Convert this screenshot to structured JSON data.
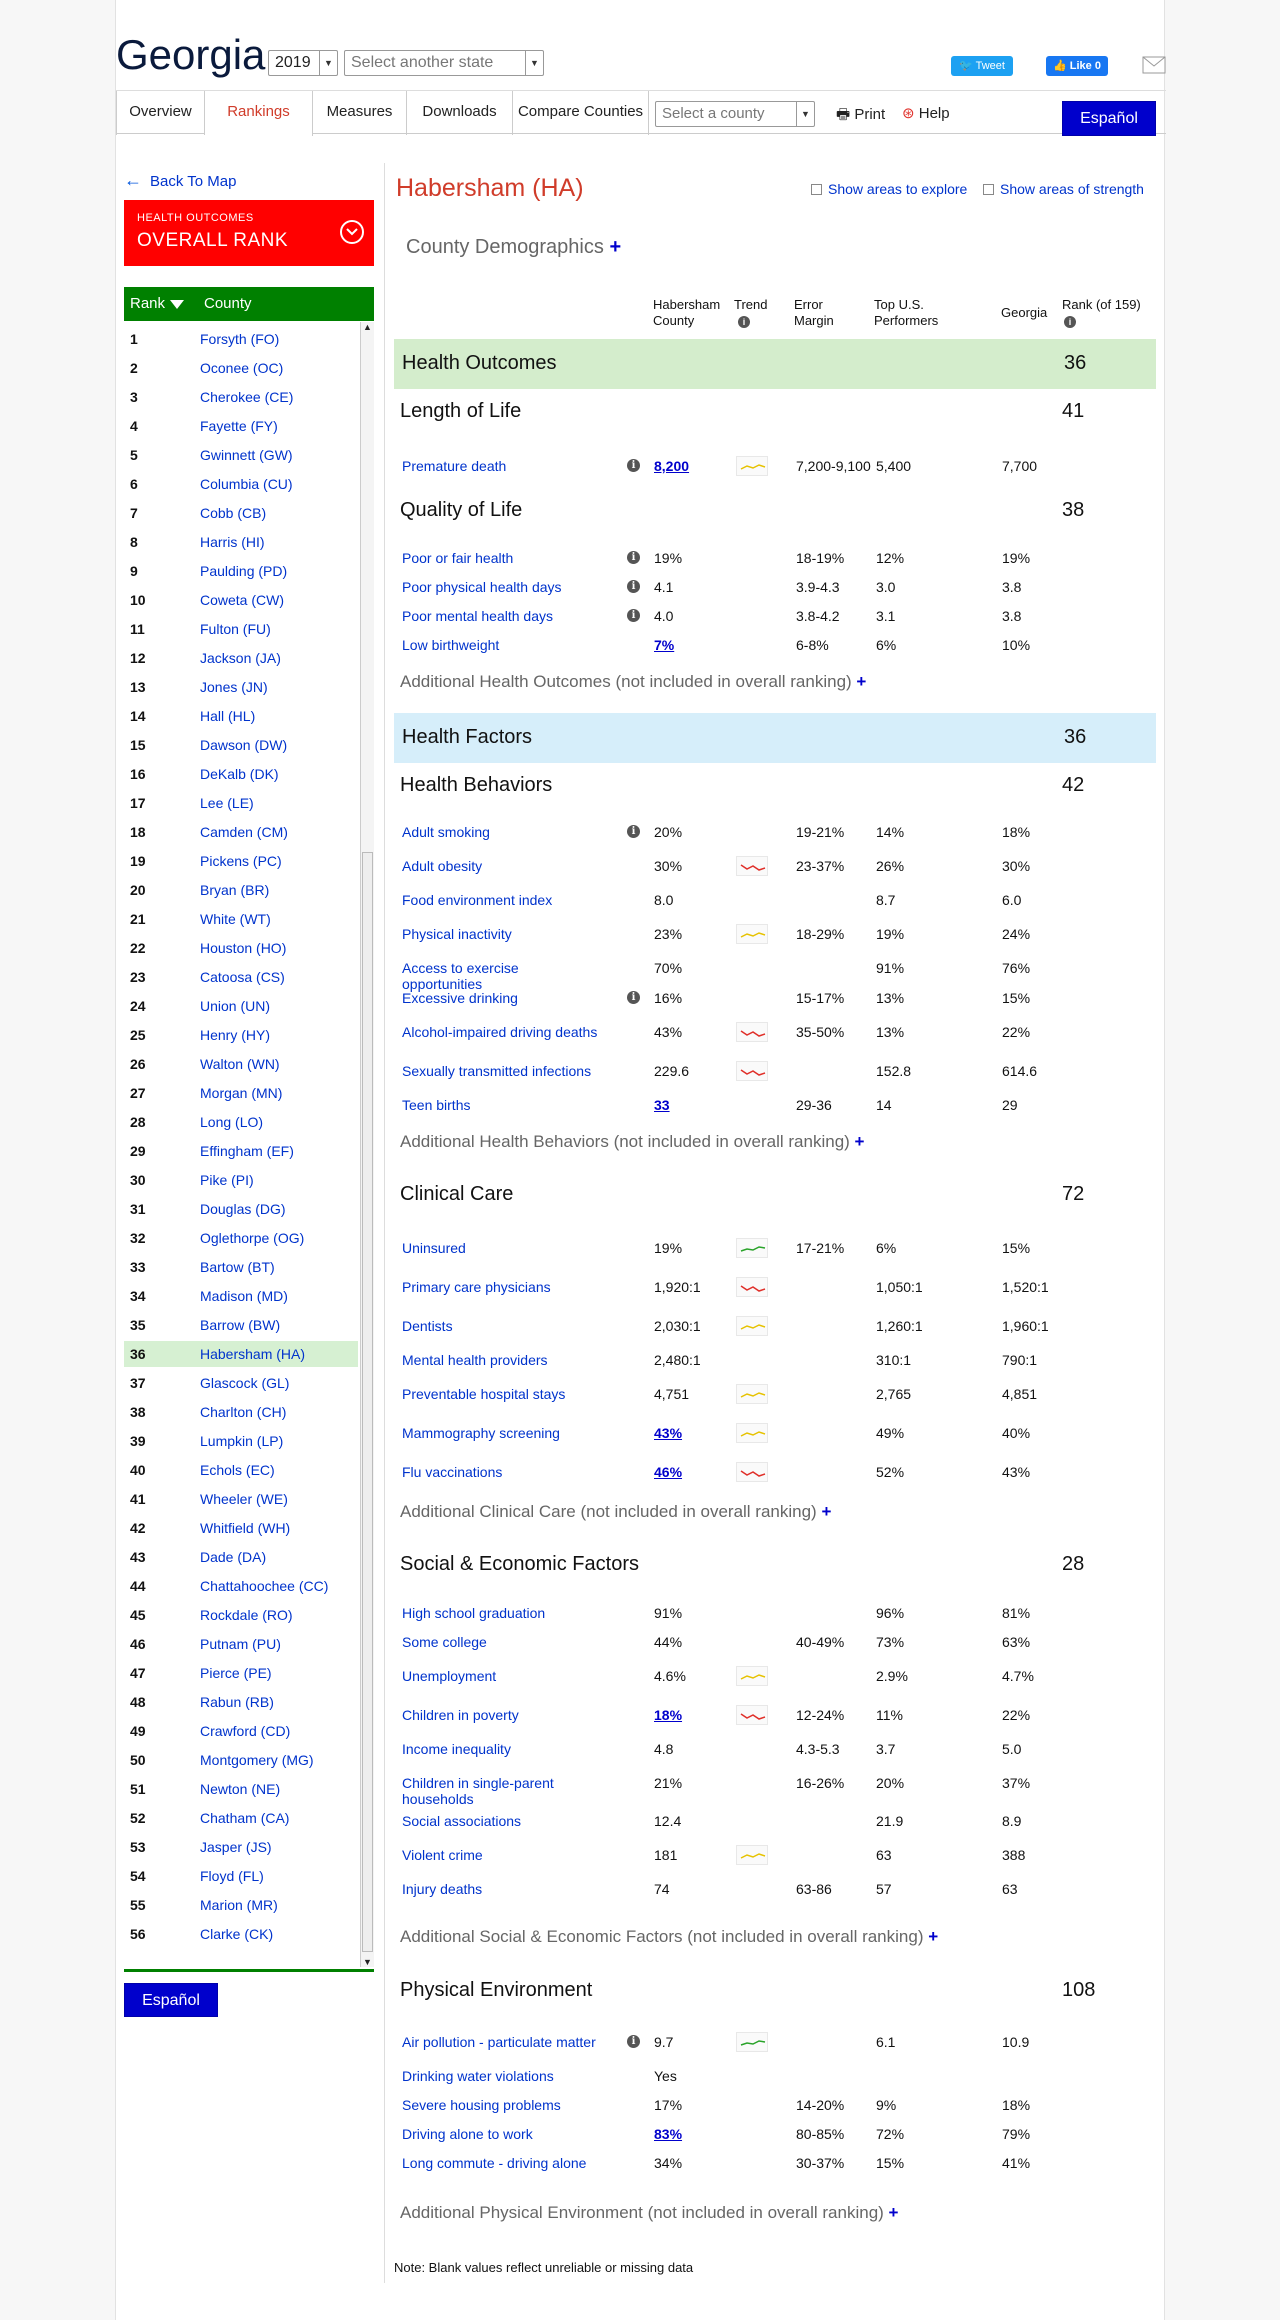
{
  "header": {
    "state": "Georgia",
    "year": "2019",
    "state_placeholder": "Select another state",
    "tweet": "Tweet",
    "like": "Like 0"
  },
  "nav": {
    "tabs": [
      "Overview",
      "Rankings",
      "Measures",
      "Downloads",
      "Compare Counties"
    ],
    "county_placeholder": "Select a county",
    "print": "Print",
    "help": "Help",
    "espanol": "Español"
  },
  "sidebar": {
    "back": "Back To Map",
    "outcomes_small": "HEALTH OUTCOMES",
    "outcomes_big": "OVERALL RANK",
    "col_rank": "Rank",
    "col_county": "County",
    "counties": [
      {
        "rank": "1",
        "name": "Forsyth (FO)"
      },
      {
        "rank": "2",
        "name": "Oconee (OC)"
      },
      {
        "rank": "3",
        "name": "Cherokee (CE)"
      },
      {
        "rank": "4",
        "name": "Fayette (FY)"
      },
      {
        "rank": "5",
        "name": "Gwinnett (GW)"
      },
      {
        "rank": "6",
        "name": "Columbia (CU)"
      },
      {
        "rank": "7",
        "name": "Cobb (CB)"
      },
      {
        "rank": "8",
        "name": "Harris (HI)"
      },
      {
        "rank": "9",
        "name": "Paulding (PD)"
      },
      {
        "rank": "10",
        "name": "Coweta (CW)"
      },
      {
        "rank": "11",
        "name": "Fulton (FU)"
      },
      {
        "rank": "12",
        "name": "Jackson (JA)"
      },
      {
        "rank": "13",
        "name": "Jones (JN)"
      },
      {
        "rank": "14",
        "name": "Hall (HL)"
      },
      {
        "rank": "15",
        "name": "Dawson (DW)"
      },
      {
        "rank": "16",
        "name": "DeKalb (DK)"
      },
      {
        "rank": "17",
        "name": "Lee (LE)"
      },
      {
        "rank": "18",
        "name": "Camden (CM)"
      },
      {
        "rank": "19",
        "name": "Pickens (PC)"
      },
      {
        "rank": "20",
        "name": "Bryan (BR)"
      },
      {
        "rank": "21",
        "name": "White (WT)"
      },
      {
        "rank": "22",
        "name": "Houston (HO)"
      },
      {
        "rank": "23",
        "name": "Catoosa (CS)"
      },
      {
        "rank": "24",
        "name": "Union (UN)"
      },
      {
        "rank": "25",
        "name": "Henry (HY)"
      },
      {
        "rank": "26",
        "name": "Walton (WN)"
      },
      {
        "rank": "27",
        "name": "Morgan (MN)"
      },
      {
        "rank": "28",
        "name": "Long (LO)"
      },
      {
        "rank": "29",
        "name": "Effingham (EF)"
      },
      {
        "rank": "30",
        "name": "Pike (PI)"
      },
      {
        "rank": "31",
        "name": "Douglas (DG)"
      },
      {
        "rank": "32",
        "name": "Oglethorpe (OG)"
      },
      {
        "rank": "33",
        "name": "Bartow (BT)"
      },
      {
        "rank": "34",
        "name": "Madison (MD)"
      },
      {
        "rank": "35",
        "name": "Barrow (BW)"
      },
      {
        "rank": "36",
        "name": "Habersham (HA)"
      },
      {
        "rank": "37",
        "name": "Glascock (GL)"
      },
      {
        "rank": "38",
        "name": "Charlton (CH)"
      },
      {
        "rank": "39",
        "name": "Lumpkin (LP)"
      },
      {
        "rank": "40",
        "name": "Echols (EC)"
      },
      {
        "rank": "41",
        "name": "Wheeler (WE)"
      },
      {
        "rank": "42",
        "name": "Whitfield (WH)"
      },
      {
        "rank": "43",
        "name": "Dade (DA)"
      },
      {
        "rank": "44",
        "name": "Chattahoochee (CC)"
      },
      {
        "rank": "45",
        "name": "Rockdale (RO)"
      },
      {
        "rank": "46",
        "name": "Putnam (PU)"
      },
      {
        "rank": "47",
        "name": "Pierce (PE)"
      },
      {
        "rank": "48",
        "name": "Rabun (RB)"
      },
      {
        "rank": "49",
        "name": "Crawford (CD)"
      },
      {
        "rank": "50",
        "name": "Montgomery (MG)"
      },
      {
        "rank": "51",
        "name": "Newton (NE)"
      },
      {
        "rank": "52",
        "name": "Chatham (CA)"
      },
      {
        "rank": "53",
        "name": "Jasper (JS)"
      },
      {
        "rank": "54",
        "name": "Floyd (FL)"
      },
      {
        "rank": "55",
        "name": "Marion (MR)"
      },
      {
        "rank": "56",
        "name": "Clarke (CK)"
      }
    ],
    "selected_rank": "36",
    "espanol": "Español"
  },
  "main": {
    "county": "Habersham (HA)",
    "show_explore": "Show areas to explore",
    "show_strength": "Show areas of strength",
    "demographics": "County Demographics",
    "columns": {
      "county": "Habersham County",
      "trend": "Trend",
      "error": "Error Margin",
      "top": "Top U.S. Performers",
      "state": "Georgia",
      "rank": "Rank (of 159)"
    },
    "outcomes": {
      "title": "Health Outcomes",
      "rank": "36"
    },
    "length": {
      "title": "Length of Life",
      "rank": "41"
    },
    "quality": {
      "title": "Quality of Life",
      "rank": "38"
    },
    "addl_outcomes": "Additional Health Outcomes (not included in overall ranking)",
    "factors": {
      "title": "Health Factors",
      "rank": "36"
    },
    "behaviors": {
      "title": "Health Behaviors",
      "rank": "42"
    },
    "addl_behaviors": "Additional Health Behaviors (not included in overall ranking)",
    "clinical": {
      "title": "Clinical Care",
      "rank": "72"
    },
    "addl_clinical": "Additional Clinical Care (not included in overall ranking)",
    "social": {
      "title": "Social & Economic Factors",
      "rank": "28"
    },
    "addl_social": "Additional Social & Economic Factors (not included in overall ranking)",
    "physical": {
      "title": "Physical Environment",
      "rank": "108"
    },
    "addl_physical": "Additional Physical Environment (not included in overall ranking)",
    "note": "Note: Blank values reflect unreliable or missing data",
    "measures": [
      {
        "label": "Premature death",
        "info": true,
        "value": "8,200",
        "link": true,
        "trend": "yellow",
        "error": "7,200-9,100",
        "top": "5,400",
        "state": "7,700"
      },
      {
        "label": "Poor or fair health",
        "info": true,
        "value": "19%",
        "link": false,
        "trend": "",
        "error": "18-19%",
        "top": "12%",
        "state": "19%"
      },
      {
        "label": "Poor physical health days",
        "info": true,
        "value": "4.1",
        "link": false,
        "trend": "",
        "error": "3.9-4.3",
        "top": "3.0",
        "state": "3.8"
      },
      {
        "label": "Poor mental health days",
        "info": true,
        "value": "4.0",
        "link": false,
        "trend": "",
        "error": "3.8-4.2",
        "top": "3.1",
        "state": "3.8"
      },
      {
        "label": "Low birthweight",
        "info": false,
        "value": "7%",
        "link": true,
        "trend": "",
        "error": "6-8%",
        "top": "6%",
        "state": "10%"
      },
      {
        "label": "Adult smoking",
        "info": true,
        "value": "20%",
        "link": false,
        "trend": "",
        "error": "19-21%",
        "top": "14%",
        "state": "18%"
      },
      {
        "label": "Adult obesity",
        "info": false,
        "value": "30%",
        "link": false,
        "trend": "red",
        "error": "23-37%",
        "top": "26%",
        "state": "30%"
      },
      {
        "label": "Food environment index",
        "info": false,
        "value": "8.0",
        "link": false,
        "trend": "",
        "error": "",
        "top": "8.7",
        "state": "6.0"
      },
      {
        "label": "Physical inactivity",
        "info": false,
        "value": "23%",
        "link": false,
        "trend": "yellow",
        "error": "18-29%",
        "top": "19%",
        "state": "24%"
      },
      {
        "label": "Access to exercise opportunities",
        "info": false,
        "value": "70%",
        "link": false,
        "trend": "",
        "error": "",
        "top": "91%",
        "state": "76%"
      },
      {
        "label": "Excessive drinking",
        "info": true,
        "value": "16%",
        "link": false,
        "trend": "",
        "error": "15-17%",
        "top": "13%",
        "state": "15%"
      },
      {
        "label": "Alcohol-impaired driving deaths",
        "info": false,
        "value": "43%",
        "link": false,
        "trend": "red",
        "error": "35-50%",
        "top": "13%",
        "state": "22%"
      },
      {
        "label": "Sexually transmitted infections",
        "info": false,
        "value": "229.6",
        "link": false,
        "trend": "red",
        "error": "",
        "top": "152.8",
        "state": "614.6"
      },
      {
        "label": "Teen births",
        "info": false,
        "value": "33",
        "link": true,
        "trend": "",
        "error": "29-36",
        "top": "14",
        "state": "29"
      },
      {
        "label": "Uninsured",
        "info": false,
        "value": "19%",
        "link": false,
        "trend": "green",
        "error": "17-21%",
        "top": "6%",
        "state": "15%"
      },
      {
        "label": "Primary care physicians",
        "info": false,
        "value": "1,920:1",
        "link": false,
        "trend": "red",
        "error": "",
        "top": "1,050:1",
        "state": "1,520:1"
      },
      {
        "label": "Dentists",
        "info": false,
        "value": "2,030:1",
        "link": false,
        "trend": "yellow",
        "error": "",
        "top": "1,260:1",
        "state": "1,960:1"
      },
      {
        "label": "Mental health providers",
        "info": false,
        "value": "2,480:1",
        "link": false,
        "trend": "",
        "error": "",
        "top": "310:1",
        "state": "790:1"
      },
      {
        "label": "Preventable hospital stays",
        "info": false,
        "value": "4,751",
        "link": false,
        "trend": "yellow",
        "error": "",
        "top": "2,765",
        "state": "4,851"
      },
      {
        "label": "Mammography screening",
        "info": false,
        "value": "43%",
        "link": true,
        "trend": "yellow",
        "error": "",
        "top": "49%",
        "state": "40%"
      },
      {
        "label": "Flu vaccinations",
        "info": false,
        "value": "46%",
        "link": true,
        "trend": "red",
        "error": "",
        "top": "52%",
        "state": "43%"
      },
      {
        "label": "High school graduation",
        "info": false,
        "value": "91%",
        "link": false,
        "trend": "",
        "error": "",
        "top": "96%",
        "state": "81%"
      },
      {
        "label": "Some college",
        "info": false,
        "value": "44%",
        "link": false,
        "trend": "",
        "error": "40-49%",
        "top": "73%",
        "state": "63%"
      },
      {
        "label": "Unemployment",
        "info": false,
        "value": "4.6%",
        "link": false,
        "trend": "yellow",
        "error": "",
        "top": "2.9%",
        "state": "4.7%"
      },
      {
        "label": "Children in poverty",
        "info": false,
        "value": "18%",
        "link": true,
        "trend": "red",
        "error": "12-24%",
        "top": "11%",
        "state": "22%"
      },
      {
        "label": "Income inequality",
        "info": false,
        "value": "4.8",
        "link": false,
        "trend": "",
        "error": "4.3-5.3",
        "top": "3.7",
        "state": "5.0"
      },
      {
        "label": "Children in single-parent households",
        "info": false,
        "value": "21%",
        "link": false,
        "trend": "",
        "error": "16-26%",
        "top": "20%",
        "state": "37%"
      },
      {
        "label": "Social associations",
        "info": false,
        "value": "12.4",
        "link": false,
        "trend": "",
        "error": "",
        "top": "21.9",
        "state": "8.9"
      },
      {
        "label": "Violent crime",
        "info": false,
        "value": "181",
        "link": false,
        "trend": "yellow",
        "error": "",
        "top": "63",
        "state": "388"
      },
      {
        "label": "Injury deaths",
        "info": false,
        "value": "74",
        "link": false,
        "trend": "",
        "error": "63-86",
        "top": "57",
        "state": "63"
      },
      {
        "label": "Air pollution - particulate matter",
        "info": true,
        "value": "9.7",
        "link": false,
        "trend": "green",
        "error": "",
        "top": "6.1",
        "state": "10.9"
      },
      {
        "label": "Drinking water violations",
        "info": false,
        "value": "Yes",
        "link": false,
        "trend": "",
        "error": "",
        "top": "",
        "state": ""
      },
      {
        "label": "Severe housing problems",
        "info": false,
        "value": "17%",
        "link": false,
        "trend": "",
        "error": "14-20%",
        "top": "9%",
        "state": "18%"
      },
      {
        "label": "Driving alone to work",
        "info": false,
        "value": "83%",
        "link": true,
        "trend": "",
        "error": "80-85%",
        "top": "72%",
        "state": "79%"
      },
      {
        "label": "Long commute - driving alone",
        "info": false,
        "value": "34%",
        "link": false,
        "trend": "",
        "error": "30-37%",
        "top": "15%",
        "state": "41%"
      }
    ],
    "trend_colors": {
      "yellow": "#e6c200",
      "red": "#e0302a",
      "green": "#29a329"
    }
  }
}
